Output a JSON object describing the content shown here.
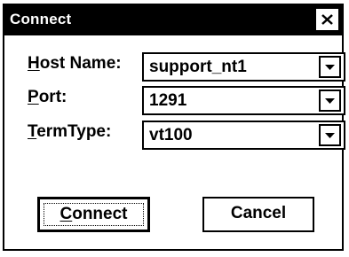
{
  "window": {
    "title": "Connect",
    "close_icon": "close-x"
  },
  "fields": [
    {
      "label": "Host Name:",
      "mnemonic": "H",
      "value": "support_nt1",
      "icon": "dropdown-arrow"
    },
    {
      "label": "Port:",
      "mnemonic": "P",
      "value": "1291",
      "icon": "dropdown-arrow"
    },
    {
      "label": "TermType:",
      "mnemonic": "T",
      "value": "vt100",
      "icon": "dropdown-arrow"
    }
  ],
  "buttons": {
    "connect": {
      "label": "Connect",
      "mnemonic": "C"
    },
    "cancel": {
      "label": "Cancel"
    }
  }
}
